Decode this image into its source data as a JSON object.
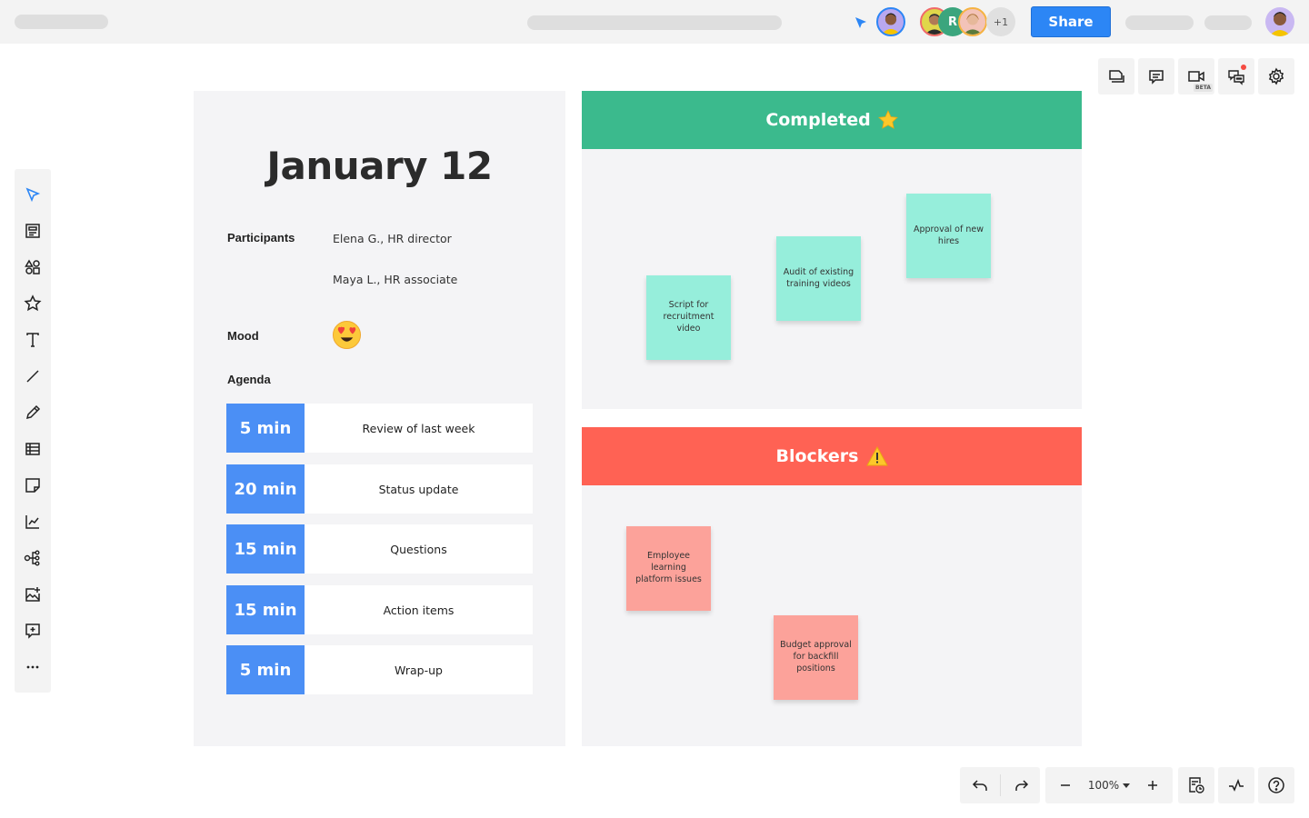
{
  "topbar": {
    "share_label": "Share",
    "collaborators": [
      {
        "name": "current-user",
        "ring": "#2c86f5"
      },
      {
        "name": "collaborator-1",
        "ring": "#f06a6a"
      },
      {
        "name": "collaborator-r",
        "initial": "R"
      },
      {
        "name": "collaborator-3",
        "ring": "#f5b342"
      }
    ],
    "extra_collaborators": "+1"
  },
  "right_tools": [
    {
      "name": "pages-icon"
    },
    {
      "name": "comments-icon"
    },
    {
      "name": "video-icon",
      "badge": "BETA"
    },
    {
      "name": "chat-icon",
      "notification": true
    },
    {
      "name": "settings-icon"
    }
  ],
  "left_tools": [
    "select-icon",
    "template-icon",
    "shapes-icon",
    "star-icon",
    "text-icon",
    "line-icon",
    "pen-icon",
    "table-icon",
    "sticky-note-icon",
    "chart-icon",
    "mindmap-icon",
    "image-icon",
    "add-comment-icon",
    "more-icon"
  ],
  "meeting": {
    "title": "January 12",
    "participants_label": "Participants",
    "participants": [
      "Elena G., HR director",
      "Maya L., HR associate"
    ],
    "mood_label": "Mood",
    "mood": "heart-eyes",
    "agenda_label": "Agenda",
    "agenda": [
      {
        "time": "5 min",
        "item": "Review of last week"
      },
      {
        "time": "20 min",
        "item": "Status update"
      },
      {
        "time": "15 min",
        "item": "Questions"
      },
      {
        "time": "15 min",
        "item": "Action items"
      },
      {
        "time": "5 min",
        "item": "Wrap-up"
      }
    ]
  },
  "completed": {
    "title": "Completed",
    "color": "#3bba8d",
    "notes": [
      "Script for recruitment video",
      "Audit of existing training videos",
      "Approval of new hires"
    ]
  },
  "blockers": {
    "title": "Blockers",
    "color": "#ff6254",
    "notes": [
      "Employee learning platform issues",
      "Budget approval for backfill positions"
    ]
  },
  "bottom": {
    "zoom": "100%"
  }
}
